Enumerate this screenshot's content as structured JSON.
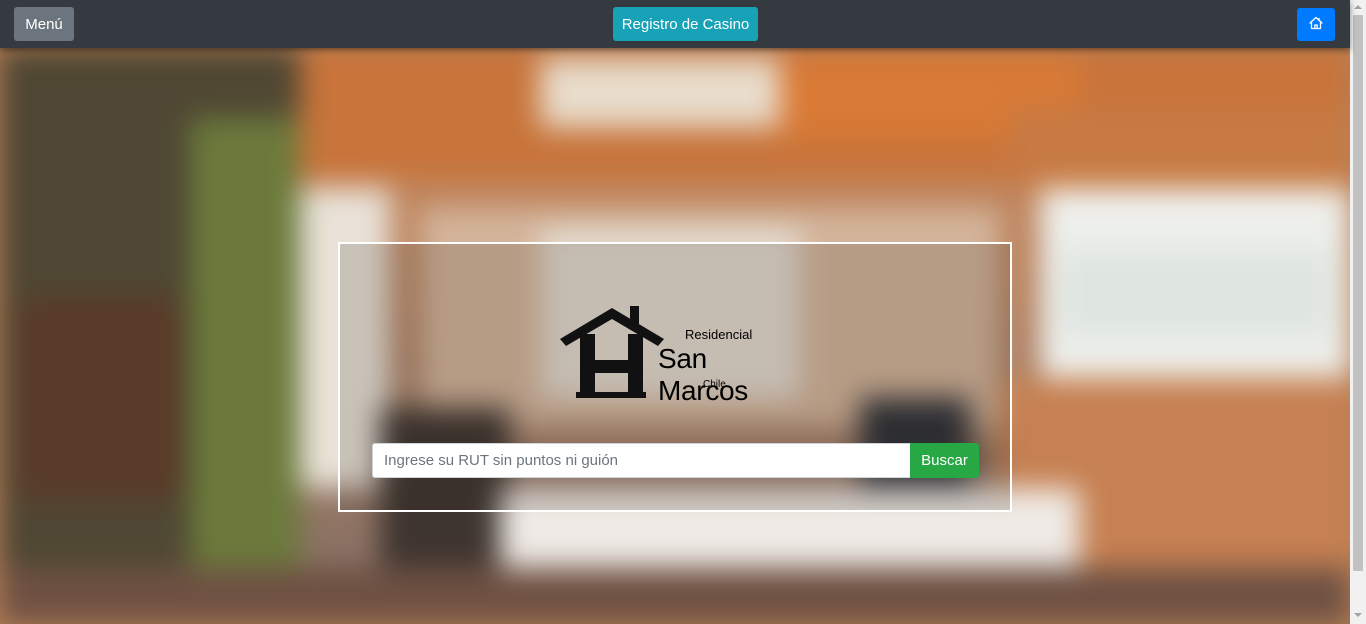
{
  "navbar": {
    "menu_label": "Menú",
    "title_button_label": "Registro de Casino",
    "home_icon": "house-icon"
  },
  "logo": {
    "line1": "Residencial",
    "line2": "San Marcos",
    "line3": "Chile",
    "icon": "house-h-logo"
  },
  "search": {
    "placeholder": "Ingrese su RUT sin puntos ni guión",
    "value": "",
    "button_label": "Buscar"
  },
  "colors": {
    "navbar_bg": "#343a40",
    "menu_button": "#6c757d",
    "title_button": "#17a2b8",
    "home_button": "#007bff",
    "search_button": "#28a745"
  }
}
